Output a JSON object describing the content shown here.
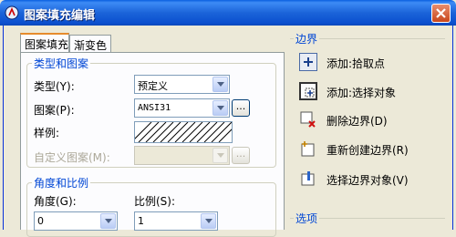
{
  "window": {
    "title": "图案填充编辑"
  },
  "tabs": [
    {
      "label": "图案填充"
    },
    {
      "label": "渐变色"
    }
  ],
  "type_group": {
    "title": "类型和图案",
    "type_label": "类型(Y):",
    "type_value": "预定义",
    "pattern_label": "图案(P):",
    "pattern_value": "ANSI31",
    "sample_label": "样例:",
    "custom_label": "自定义图案(M):",
    "custom_value": "",
    "ellipsis": "..."
  },
  "angle_group": {
    "title": "角度和比例",
    "angle_label": "角度(G):",
    "angle_value": "0",
    "scale_label": "比例(S):",
    "scale_value": "1"
  },
  "boundary": {
    "title": "边界",
    "buttons": [
      {
        "label": "添加:拾取点",
        "icon": "pick-point-icon"
      },
      {
        "label": "添加:选择对象",
        "icon": "select-objects-icon"
      },
      {
        "label": "删除边界(D)",
        "icon": "remove-boundary-icon"
      },
      {
        "label": "重新创建边界(R)",
        "icon": "recreate-boundary-icon"
      },
      {
        "label": "选择边界对象(V)",
        "icon": "select-boundary-objects-icon"
      }
    ]
  },
  "options": {
    "title": "选项"
  }
}
